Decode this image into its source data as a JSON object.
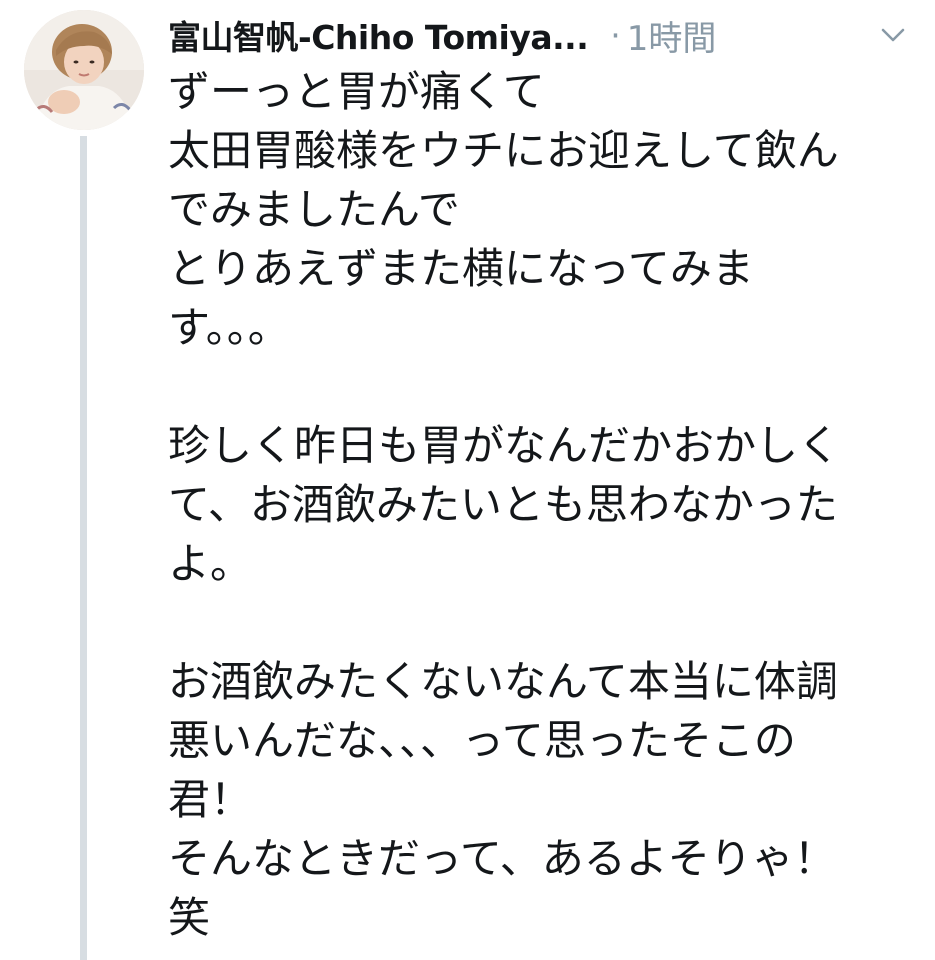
{
  "tweet": {
    "display_name": "富山智帆-Chiho Tomiya...",
    "separator": "·",
    "timestamp": "1時間",
    "icons": {
      "avatar": "profile-photo",
      "menu": "chevron-down-icon"
    },
    "colors": {
      "text": "#14171a",
      "secondary": "#8899a6",
      "thread_line": "#d7dde2"
    },
    "body_lines": [
      "ずーっと胃が痛くて",
      "太田胃酸様をウチにお迎えして飲ん",
      "でみましたんで",
      "とりあえずまた横になってみま",
      "す。。。",
      "",
      "珍しく昨日も胃がなんだかおかしく",
      "て、お酒飲みたいとも思わなかった",
      "よ。",
      "",
      "お酒飲みたくないなんて本当に体調",
      "悪いんだな、、、って思ったそこの",
      "君！",
      "そんなときだって、あるよそりゃ！",
      "笑"
    ]
  }
}
